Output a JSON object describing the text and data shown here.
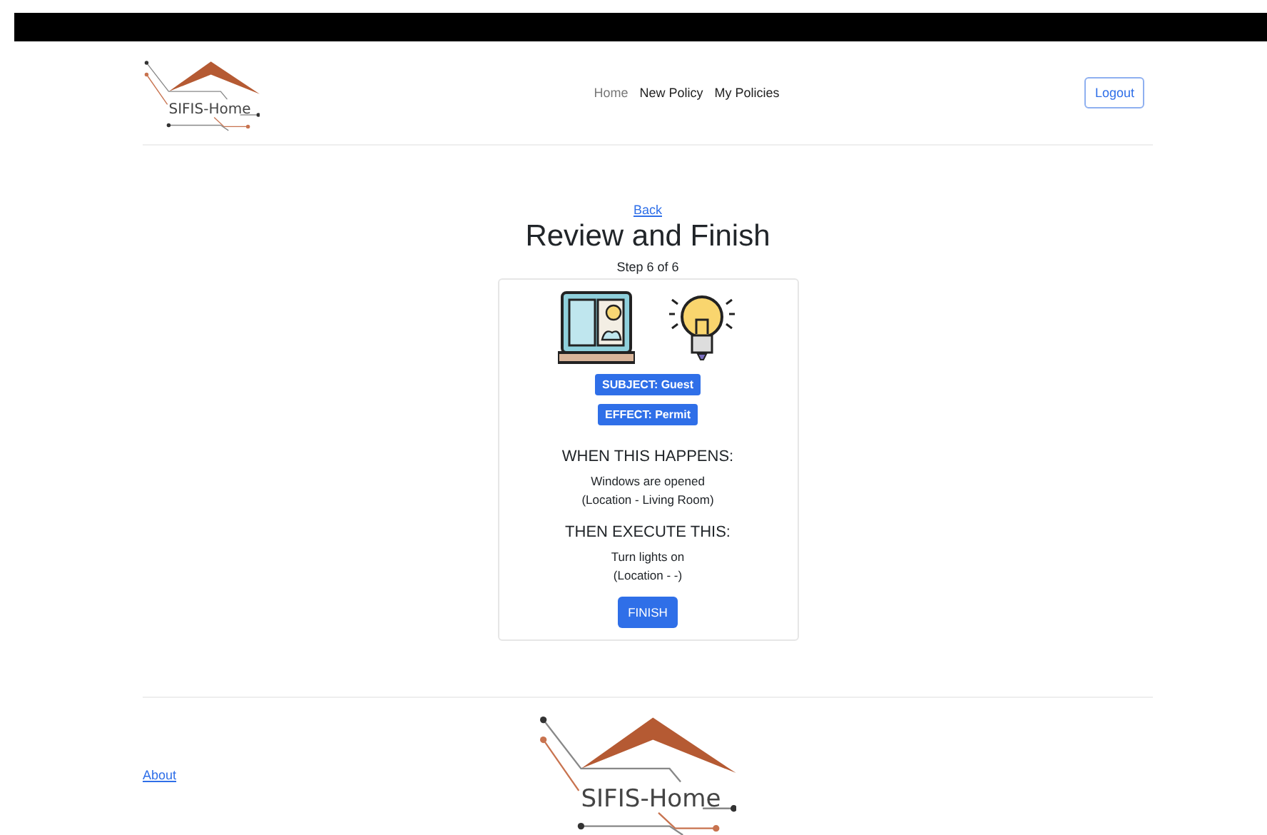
{
  "header": {
    "logo_text": "SIFIS-Home",
    "nav": [
      {
        "label": "Home",
        "selected": true
      },
      {
        "label": "New Policy",
        "selected": false
      },
      {
        "label": "My Policies",
        "selected": false
      }
    ],
    "logout": "Logout"
  },
  "main": {
    "back": "Back",
    "title": "Review and Finish",
    "step": "Step 6 of 6",
    "card": {
      "badges": [
        "SUBJECT: Guest",
        "EFFECT: Permit"
      ],
      "sections": [
        {
          "heading": "WHEN THIS HAPPENS:",
          "lines": [
            "Windows are opened",
            "(Location - Living Room)"
          ]
        },
        {
          "heading": "THEN EXECUTE THIS:",
          "lines": [
            "Turn lights on",
            "(Location - -)"
          ]
        }
      ],
      "button": "FINISH"
    }
  },
  "footer": {
    "about": "About",
    "logo_text": "SIFIS-Home"
  }
}
